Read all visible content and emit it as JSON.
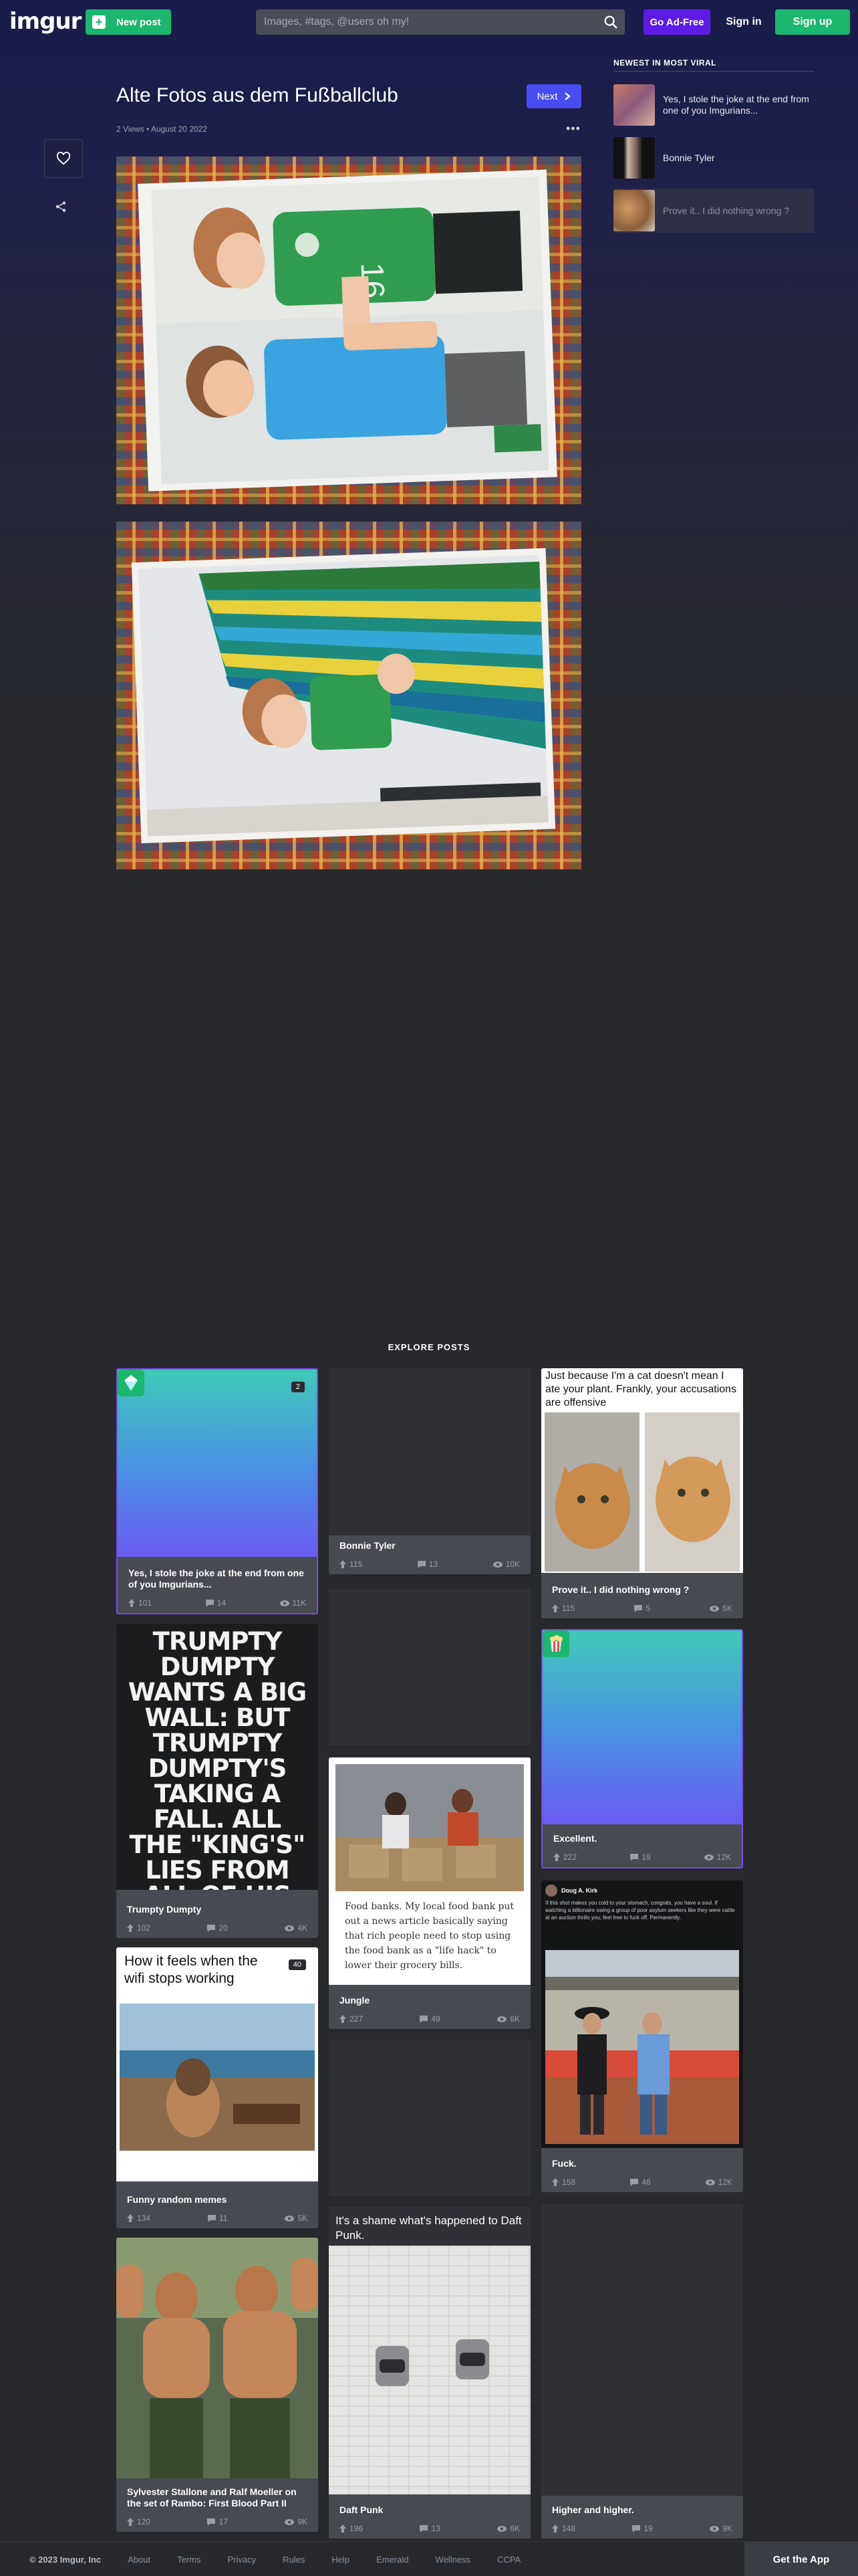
{
  "header": {
    "logo": "imgur",
    "new_post_label": "New post",
    "search_placeholder": "Images, #tags, @users oh my!",
    "go_adfree_label": "Go Ad-Free",
    "signin_label": "Sign in",
    "signup_label": "Sign up"
  },
  "post": {
    "title": "Alte Fotos aus dem Fußballclub",
    "meta": "2 Views • August 20 2022",
    "next_label": "Next"
  },
  "sidebar": {
    "title": "NEWEST IN MOST VIRAL",
    "items": [
      {
        "label": "Yes, I stole the joke at the end from one of you Imgurians..."
      },
      {
        "label": "Bonnie Tyler"
      },
      {
        "label": "Prove it.. I did nothing wrong ?"
      }
    ]
  },
  "explore": {
    "title": "EXPLORE POSTS",
    "cards": [
      {
        "title": "Yes, I stole the joke at the end from one of you Imgurians...",
        "ups": "101",
        "comments": "14",
        "views": "11K",
        "count": "2"
      },
      {
        "title": "Bonnie Tyler",
        "ups": "115",
        "comments": "13",
        "views": "10K"
      },
      {
        "title": "Prove it.. I did nothing wrong ?",
        "ups": "115",
        "comments": "5",
        "views": "5K",
        "caption": "Just because I'm a cat doesn't mean I ate your plant. Frankly, your accusations are offensive"
      },
      {
        "title": "Trumpty Dumpty",
        "ups": "102",
        "comments": "20",
        "views": "4K",
        "poster_text": "TRUMPTY DUMPTY WANTS A BIG WALL: BUT TRUMPTY DUMPTY'S TAKING A FALL. ALL THE \"KING'S\" LIES FROM ALL OF HIS MEN WON'T KEEP TRUMPTY OUT OF THE PEN"
      },
      {
        "title": "Excellent.",
        "ups": "222",
        "comments": "19",
        "views": "12K"
      },
      {
        "title": "Jungle",
        "ups": "227",
        "comments": "49",
        "views": "6K",
        "quote": "Food banks. My local food bank put out a news article basically saying that rich people need to stop using the food bank as a \"life hack\" to lower their grocery bills."
      },
      {
        "title": "Funny random memes",
        "ups": "134",
        "comments": "11",
        "views": "5K",
        "caption": "How it feels when the wifi stops working",
        "count": "40"
      },
      {
        "title": "Fuck.",
        "ups": "158",
        "comments": "46",
        "views": "12K",
        "tweet_name": "Doug A. Kirk",
        "tweet_text": "If this shot makes you cold to your stomach, congrats, you have a soul. If watching a billionaire swing a group of poor asylum seekers like they were cattle at an auction thrills you, feel free to fuck off. Permanently."
      },
      {
        "title": "Sylvester Stallone and Ralf Moeller on the set of Rambo: First Blood Part II",
        "ups": "120",
        "comments": "17",
        "views": "9K"
      },
      {
        "title": "Daft Punk",
        "ups": "196",
        "comments": "13",
        "views": "6K",
        "caption": "It's a shame what's happened to Daft Punk."
      },
      {
        "title": "Higher and higher.",
        "ups": "148",
        "comments": "19",
        "views": "9K"
      }
    ]
  },
  "footer": {
    "links": [
      "© 2023 Imgur, Inc",
      "About",
      "Terms",
      "Privacy",
      "Rules",
      "Help",
      "Emerald",
      "Wellness",
      "CCPA"
    ],
    "get_app_label": "Get the App"
  },
  "colors": {
    "green": "#1bb76e",
    "purple": "#5c1ce6",
    "next_blue": "#474df1",
    "background": "#27292d"
  }
}
